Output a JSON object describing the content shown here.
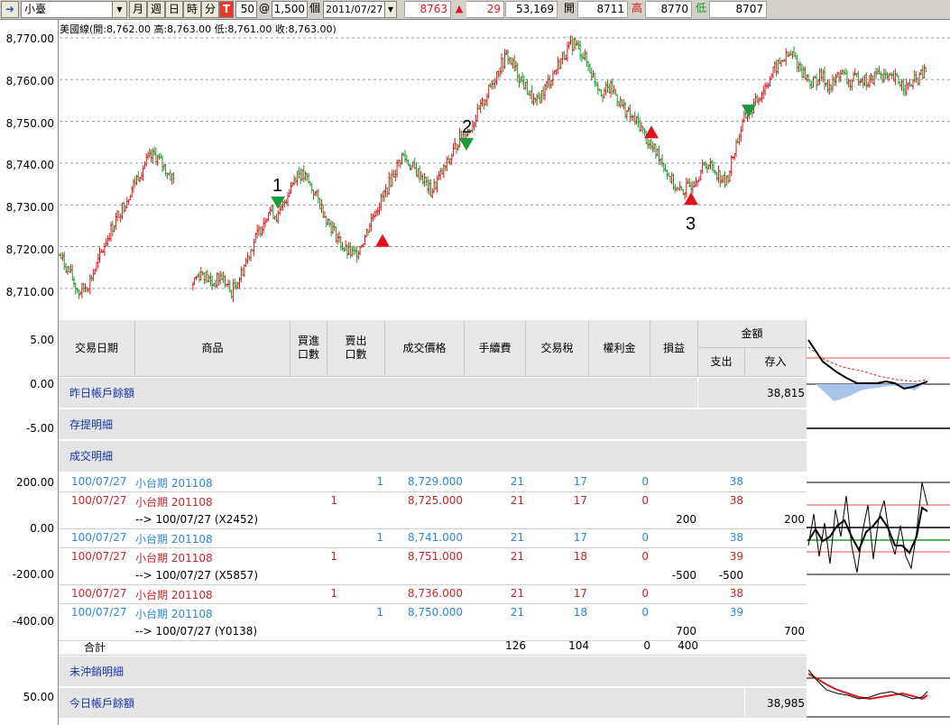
{
  "toolbar": {
    "symbol": "小臺",
    "period_buttons": [
      "月",
      "週",
      "日",
      "時",
      "分"
    ],
    "t_button": "T",
    "interval": "50",
    "at_sign": "@",
    "quantity": "1,500",
    "quantity_unit": "個",
    "date": "2011/07/27",
    "last_price": "8763",
    "change": "29",
    "volume": "53,169",
    "open_label": "開",
    "open_value": "8711",
    "high_label": "高",
    "high_value": "8770",
    "low_label": "低",
    "low_value": "8707"
  },
  "chart": {
    "legend": "美國線(開:8,762.00 高:8,763.00 低:8,761.00 收:8,763.00)",
    "y_labels": [
      "8,770.00",
      "8,760.00",
      "8,750.00",
      "8,740.00",
      "8,730.00",
      "8,720.00",
      "8,710.00"
    ],
    "trade_labels": [
      "1",
      "2",
      "3"
    ]
  },
  "chart_data": {
    "type": "ohlc",
    "ylim": [
      8705,
      8770
    ],
    "close_path": [
      8718,
      8714,
      8709,
      8711,
      8716,
      8722,
      8727,
      8731,
      8736,
      8740,
      8742,
      8739,
      8736,
      null,
      8712,
      8714,
      8711,
      8713,
      8709,
      8713,
      8719,
      8724,
      8729,
      8727,
      8733,
      8738,
      8736,
      8732,
      8727,
      8723,
      8719,
      8718,
      8722,
      8728,
      8732,
      8737,
      8742,
      8739,
      8737,
      8733,
      8737,
      8741,
      8746,
      8748,
      8752,
      8757,
      8762,
      8766,
      8762,
      8758,
      8754,
      8758,
      8762,
      8766,
      8769,
      8766,
      8761,
      8757,
      8758,
      8754,
      8751,
      8749,
      8744,
      8742,
      8737,
      8733,
      8734,
      8737,
      8740,
      8738,
      8735,
      8744,
      8751,
      8754,
      8758,
      8762,
      8765,
      8766,
      8762,
      8759,
      8761,
      8758,
      8762,
      8759,
      8761,
      8759,
      8762,
      8760,
      8760,
      8758,
      8760,
      8762
    ],
    "markers": [
      {
        "label": "1",
        "type": "sell",
        "price": 8730.5
      },
      {
        "type": "buy",
        "price": 8721.5
      },
      {
        "label": "2",
        "type": "sell",
        "price": 8744.5
      },
      {
        "type": "buy",
        "price": 8747.5
      },
      {
        "label": "3",
        "type": "buy",
        "price": 8731.5
      },
      {
        "type": "sell",
        "price": 8752.5
      }
    ]
  },
  "left_axes": {
    "panel1": [
      "5.00",
      "0.00",
      "-5.00"
    ],
    "panel2": [
      "200.00",
      "0.00",
      "-200.00",
      "-400.00"
    ],
    "panel3": [
      "50.00"
    ]
  },
  "report": {
    "headers": {
      "date": "交易日期",
      "product": "商品",
      "buy_qty": "買進\n口數",
      "sell_qty": "賣出\n口數",
      "price": "成交價格",
      "fee": "手續費",
      "tax": "交易稅",
      "premium": "權利金",
      "pnl": "損益",
      "amount": "金額",
      "out": "支出",
      "in": "存入"
    },
    "prev_balance_label": "昨日帳戶餘額",
    "prev_balance_value": "38,815",
    "deposit_label": "存提明細",
    "trades_label": "成交明細",
    "rows": [
      {
        "date": "100/07/27",
        "product": "小台期 201108",
        "buy": "",
        "sell": "1",
        "price": "8,729.000",
        "fee": "21",
        "tax": "17",
        "prem": "0",
        "pnl": "",
        "out": "38",
        "in": "",
        "color": "blue"
      },
      {
        "date": "100/07/27",
        "product": "小台期 201108",
        "buy": "1",
        "sell": "",
        "price": "8,725.000",
        "fee": "21",
        "tax": "17",
        "prem": "0",
        "pnl": "",
        "out": "38",
        "in": "",
        "color": "red"
      },
      {
        "sub": "--> 100/07/27 (X2452)",
        "pnl": "200",
        "out": "",
        "in": "200"
      },
      {
        "date": "100/07/27",
        "product": "小台期 201108",
        "buy": "",
        "sell": "1",
        "price": "8,741.000",
        "fee": "21",
        "tax": "17",
        "prem": "0",
        "pnl": "",
        "out": "38",
        "in": "",
        "color": "blue"
      },
      {
        "date": "100/07/27",
        "product": "小台期 201108",
        "buy": "1",
        "sell": "",
        "price": "8,751.000",
        "fee": "21",
        "tax": "18",
        "prem": "0",
        "pnl": "",
        "out": "39",
        "in": "",
        "color": "red"
      },
      {
        "sub": "--> 100/07/27 (X5857)",
        "pnl": "-500",
        "out": "-500",
        "in": ""
      },
      {
        "date": "100/07/27",
        "product": "小台期 201108",
        "buy": "1",
        "sell": "",
        "price": "8,736.000",
        "fee": "21",
        "tax": "17",
        "prem": "0",
        "pnl": "",
        "out": "38",
        "in": "",
        "color": "red"
      },
      {
        "date": "100/07/27",
        "product": "小台期 201108",
        "buy": "",
        "sell": "1",
        "price": "8,750.000",
        "fee": "21",
        "tax": "18",
        "prem": "0",
        "pnl": "",
        "out": "39",
        "in": "",
        "color": "blue"
      },
      {
        "sub": "--> 100/07/27 (Y0138)",
        "pnl": "700",
        "out": "",
        "in": "700"
      }
    ],
    "total": {
      "label": "合計",
      "fee": "126",
      "tax": "104",
      "prem": "0",
      "pnl": "400"
    },
    "open_positions_label": "未沖銷明細",
    "today_balance_label": "今日帳戶餘額",
    "today_balance_value": "38,985"
  },
  "colors": {
    "up": "#d8191f",
    "down": "#1a9a2a",
    "sell_marker": "#1f9a3a",
    "buy_marker": "#e0141c",
    "blue_text": "#2f86d6",
    "red_text": "#c4242b"
  }
}
